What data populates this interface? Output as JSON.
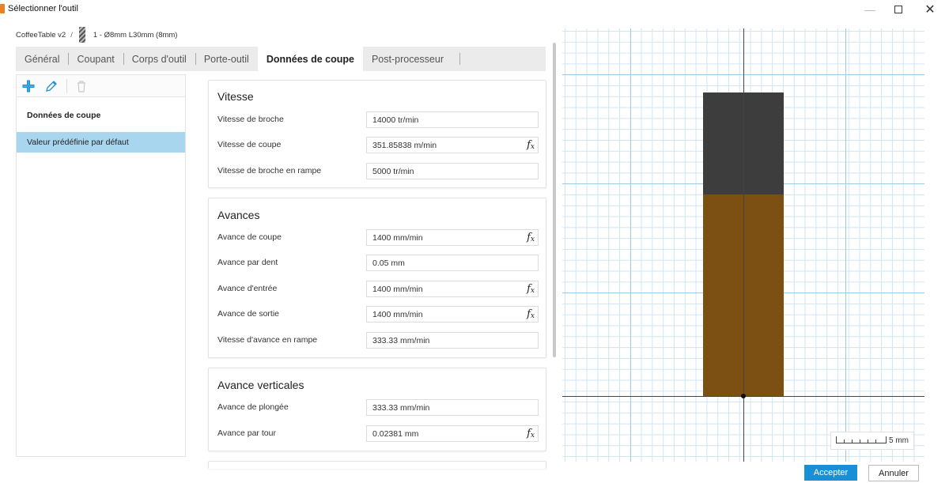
{
  "window": {
    "title": "Sélectionner l'outil",
    "minimize_glyph": "—",
    "close_glyph": "✕"
  },
  "breadcrumb": {
    "document": "CoffeeTable v2",
    "separator": "/",
    "tool": "1 - Ø8mm L30mm (8mm)"
  },
  "tabs": [
    {
      "label": "Général"
    },
    {
      "label": "Coupant"
    },
    {
      "label": "Corps d'outil"
    },
    {
      "label": "Porte-outil"
    },
    {
      "label": "Données de coupe",
      "active": true
    },
    {
      "label": "Post-processeur"
    }
  ],
  "left_panel": {
    "toolbar_icons": [
      "add-icon",
      "edit-icon",
      "delete-icon"
    ],
    "items": [
      {
        "label": "Données de coupe"
      },
      {
        "label": "Valeur prédéfinie par défaut",
        "selected": true
      }
    ]
  },
  "sections": {
    "vitesse": {
      "title": "Vitesse",
      "rows": [
        {
          "label": "Vitesse de broche",
          "value": "14000 tr/min"
        },
        {
          "label": "Vitesse de coupe",
          "value": "351.85838 m/min",
          "fx": true
        },
        {
          "label": "Vitesse de broche en rampe",
          "value": "5000 tr/min"
        }
      ]
    },
    "avances": {
      "title": "Avances",
      "rows": [
        {
          "label": "Avance de coupe",
          "value": "1400 mm/min",
          "fx": true
        },
        {
          "label": "Avance par dent",
          "value": "0.05 mm"
        },
        {
          "label": "Avance d'entrée",
          "value": "1400 mm/min",
          "fx": true
        },
        {
          "label": "Avance de sortie",
          "value": "1400 mm/min",
          "fx": true
        },
        {
          "label": "Vitesse d'avance en rampe",
          "value": "333.33 mm/min"
        }
      ]
    },
    "verticales": {
      "title": "Avance verticales",
      "rows": [
        {
          "label": "Avance de plongée",
          "value": "333.33 mm/min"
        },
        {
          "label": "Avance par tour",
          "value": "0.02381 mm",
          "fx": true
        }
      ]
    }
  },
  "fx_label": "f",
  "fx_sub": "x",
  "preview": {
    "scale_label": "5 mm",
    "holder_color": "#3d3d3d",
    "body_color": "#7b5012"
  },
  "footer": {
    "accept": "Accepter",
    "cancel": "Annuler"
  },
  "colors": {
    "accent": "#1a8fd6",
    "selection": "#a8d6ef"
  }
}
